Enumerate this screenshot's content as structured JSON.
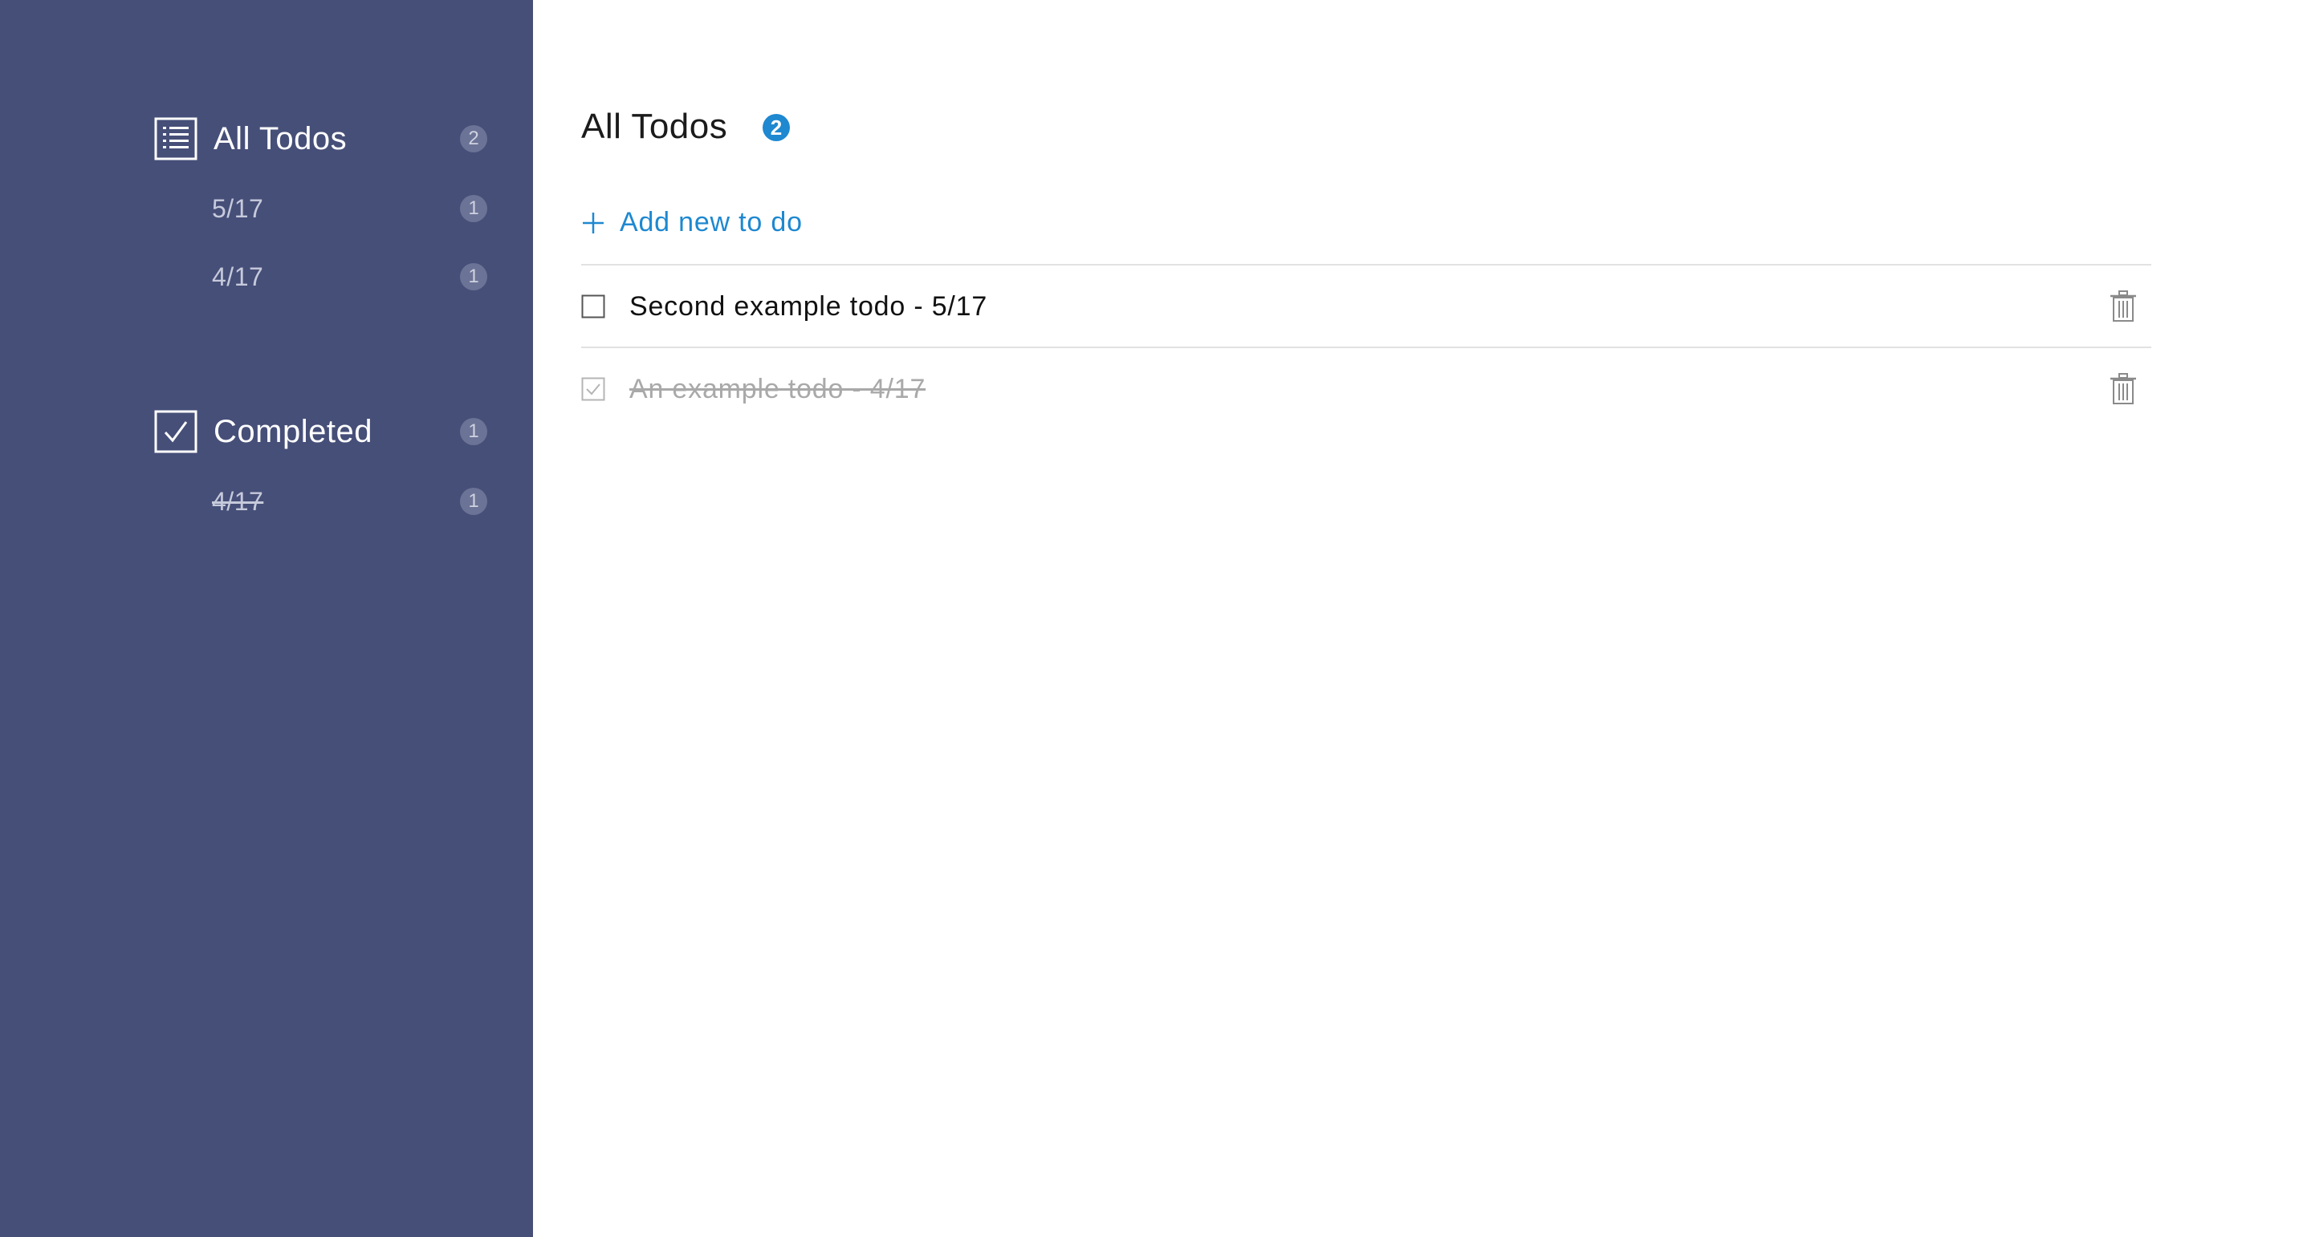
{
  "sidebar": {
    "all": {
      "title": "All Todos",
      "count": "2",
      "icon": "list-icon",
      "items": [
        {
          "label": "5/17",
          "count": "1"
        },
        {
          "label": "4/17",
          "count": "1"
        }
      ]
    },
    "completed": {
      "title": "Completed",
      "count": "1",
      "icon": "check-square-icon",
      "items": [
        {
          "label": "4/17",
          "count": "1"
        }
      ]
    }
  },
  "main": {
    "title": "All Todos",
    "count": "2",
    "add_label": "Add new to do",
    "todos": [
      {
        "text": "Second example todo - 5/17",
        "done": false
      },
      {
        "text": "An example todo - 4/17",
        "done": true
      }
    ]
  },
  "colors": {
    "sidebar_bg": "#464f78",
    "accent": "#1e88d0",
    "badge_bg": "#6b7396",
    "done_text": "#a9a9a9"
  },
  "icons": [
    "list-icon",
    "check-square-icon",
    "plus-icon",
    "checkbox-icon",
    "trash-icon"
  ]
}
